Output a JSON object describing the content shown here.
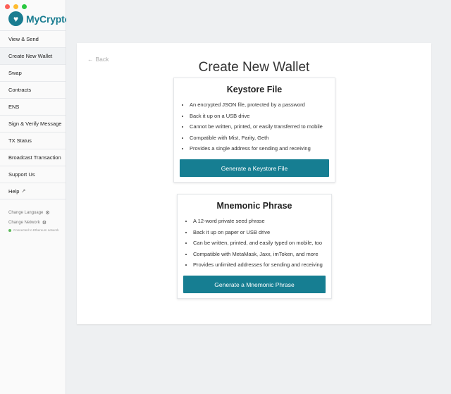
{
  "app": {
    "name": "MyCrypto"
  },
  "colors": {
    "accent": "#167e92",
    "connected": "#5dba5a"
  },
  "sidebar": {
    "items": [
      {
        "label": "View & Send"
      },
      {
        "label": "Create New Wallet",
        "active": true
      },
      {
        "label": "Swap"
      },
      {
        "label": "Contracts"
      },
      {
        "label": "ENS"
      },
      {
        "label": "Sign & Verify Message"
      },
      {
        "label": "TX Status"
      },
      {
        "label": "Broadcast Transaction"
      },
      {
        "label": "Support Us"
      },
      {
        "label": "Help",
        "external_icon": "external-link-icon"
      }
    ],
    "change_language": "Change Language",
    "change_network": "Change Network",
    "connection_status": "Connected to Ethereum network"
  },
  "main": {
    "back_label": "Back",
    "title": "Create New Wallet",
    "keystore": {
      "heading": "Keystore File",
      "bullets": [
        "An encrypted JSON file, protected by a password",
        "Back it up on a USB drive",
        "Cannot be written, printed, or easily transferred to mobile",
        "Compatible with Mist, Parity, Geth",
        "Provides a single address for sending and receiving"
      ],
      "button": "Generate a Keystore File"
    },
    "mnemonic": {
      "heading": "Mnemonic Phrase",
      "bullets": [
        "A 12-word private seed phrase",
        "Back it up on paper or USB drive",
        "Can be written, printed, and easily typed on mobile, too",
        "Compatible with MetaMask, Jaxx, imToken, and more",
        "Provides unlimited addresses for sending and receiving"
      ],
      "button": "Generate a Mnemonic Phrase"
    }
  }
}
